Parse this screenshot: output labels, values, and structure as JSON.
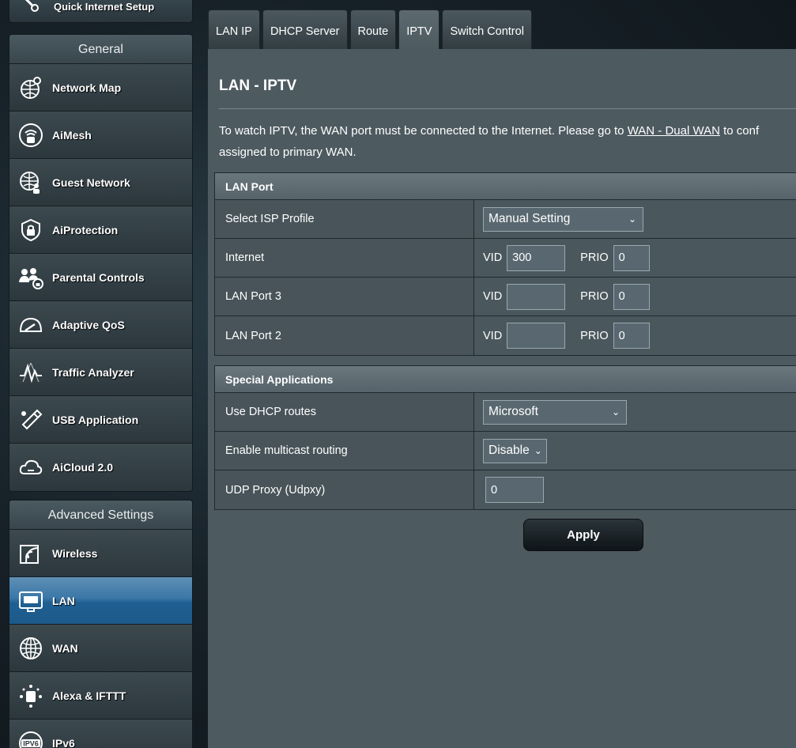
{
  "sidebar": {
    "qis_label": "Quick Internet Setup",
    "general": {
      "header": "General",
      "items": [
        {
          "label": "Network Map",
          "icon": "network-map-icon"
        },
        {
          "label": "AiMesh",
          "icon": "aimesh-icon"
        },
        {
          "label": "Guest Network",
          "icon": "guest-network-icon"
        },
        {
          "label": "AiProtection",
          "icon": "aiprotection-icon"
        },
        {
          "label": "Parental Controls",
          "icon": "parental-controls-icon"
        },
        {
          "label": "Adaptive QoS",
          "icon": "adaptive-qos-icon"
        },
        {
          "label": "Traffic Analyzer",
          "icon": "traffic-analyzer-icon"
        },
        {
          "label": "USB Application",
          "icon": "usb-application-icon"
        },
        {
          "label": "AiCloud 2.0",
          "icon": "aicloud-icon"
        }
      ]
    },
    "advanced": {
      "header": "Advanced Settings",
      "items": [
        {
          "label": "Wireless",
          "icon": "wireless-icon"
        },
        {
          "label": "LAN",
          "icon": "lan-icon",
          "active": true
        },
        {
          "label": "WAN",
          "icon": "wan-icon"
        },
        {
          "label": "Alexa & IFTTT",
          "icon": "alexa-icon"
        },
        {
          "label": "IPv6",
          "icon": "ipv6-icon"
        }
      ]
    }
  },
  "tabs": [
    "LAN IP",
    "DHCP Server",
    "Route",
    "IPTV",
    "Switch Control"
  ],
  "active_tab": "IPTV",
  "page": {
    "title": "LAN - IPTV",
    "desc_before": "To watch IPTV, the WAN port must be connected to the Internet. Please go to ",
    "desc_link": "WAN - Dual WAN",
    "desc_after": " to conf",
    "desc_line2": "assigned to primary WAN."
  },
  "lan_port": {
    "header": "LAN Port",
    "isp_profile_label": "Select ISP Profile",
    "isp_profile_value": "Manual Setting",
    "vid_label": "VID",
    "prio_label": "PRIO",
    "rows": [
      {
        "label": "Internet",
        "vid": "300",
        "prio": "0"
      },
      {
        "label": "LAN Port 3",
        "vid": "",
        "prio": "0"
      },
      {
        "label": "LAN Port 2",
        "vid": "",
        "prio": "0"
      }
    ]
  },
  "special": {
    "header": "Special Applications",
    "dhcp_routes_label": "Use DHCP routes",
    "dhcp_routes_value": "Microsoft",
    "multicast_label": "Enable multicast routing",
    "multicast_value": "Disable",
    "udpxy_label": "UDP Proxy (Udpxy)",
    "udpxy_value": "0"
  },
  "apply_label": "Apply"
}
